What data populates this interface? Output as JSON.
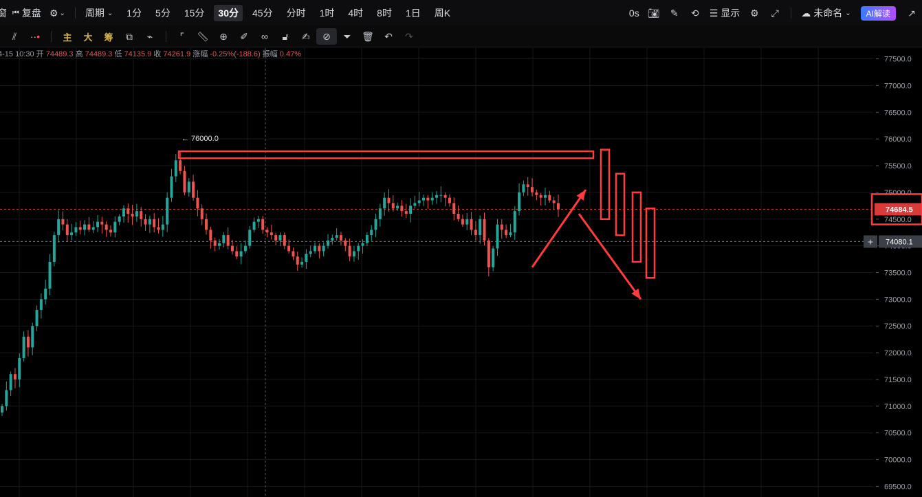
{
  "topbar": {
    "left_fragment": "窗",
    "replay_label": "复盘",
    "period_label": "周期",
    "timeframes": [
      "1分",
      "5分",
      "15分",
      "30分",
      "45分",
      "分时",
      "1时",
      "4时",
      "8时",
      "1日",
      "周K"
    ],
    "active_timeframe": "30分",
    "countdown": "0s",
    "display_label": "显示",
    "layout_name": "未命名",
    "ai_label": "AI解读"
  },
  "toolbar": {
    "indicator_main": "主",
    "indicator_big": "大",
    "indicator_chip": "筹"
  },
  "ohlc": {
    "date": "4-15 10:30",
    "open_label": "开",
    "open": "74489.3",
    "high_label": "高",
    "high": "74489.3",
    "low_label": "低",
    "low": "74135.9",
    "close_label": "收",
    "close": "74261.9",
    "change_label": "涨幅",
    "change": "-0.25%(-188.6)",
    "amp_label": "振幅",
    "amp": "0.47%"
  },
  "colors": {
    "up": "#26a69a",
    "down": "#ef5350",
    "annotation": "#ff3b3b",
    "price_badge": "#d93b3b",
    "cursor_badge": "#3a3f48",
    "grid": "#16181c"
  },
  "chart_data": {
    "type": "candlestick",
    "y_axis_ticks": [
      "77500.0",
      "77000.0",
      "76500.0",
      "76000.0",
      "75500.0",
      "75000.0",
      "74500.0",
      "74000.0",
      "73500.0",
      "73000.0",
      "72500.0",
      "72000.0",
      "71500.0",
      "71000.0",
      "70500.0",
      "70000.0",
      "69500.0"
    ],
    "ylim": [
      69300,
      77700
    ],
    "high_marker": "76000.0",
    "last_price": "74684.5",
    "cursor_price": "74080.1",
    "path": [
      71000,
      71300,
      71600,
      71500,
      71900,
      72300,
      72100,
      72500,
      72800,
      73000,
      73200,
      73700,
      74200,
      74500,
      74400,
      74200,
      74250,
      74350,
      74300,
      74400,
      74300,
      74350,
      74450,
      74400,
      74300,
      74250,
      74450,
      74550,
      74700,
      74600,
      74550,
      74650,
      74500,
      74400,
      74500,
      74350,
      74300,
      74400,
      74900,
      75300,
      75600,
      75400,
      75000,
      75200,
      74900,
      74700,
      74500,
      74300,
      74100,
      74000,
      74050,
      74200,
      74000,
      73900,
      73800,
      73900,
      74000,
      74300,
      74450,
      74500,
      74300,
      74250,
      74200,
      74100,
      74200,
      74000,
      73900,
      73800,
      73650,
      73700,
      73850,
      73900,
      74000,
      73900,
      74000,
      74100,
      74150,
      74200,
      74100,
      74000,
      73800,
      73900,
      74000,
      74050,
      74200,
      74300,
      74500,
      74700,
      74900,
      74800,
      74700,
      74750,
      74650,
      74600,
      74750,
      74800,
      74850,
      74900,
      74850,
      74900,
      74950,
      74950,
      74900,
      74800,
      74600,
      74500,
      74400,
      74500,
      74300,
      74200,
      74500,
      74100,
      73600,
      73950,
      74400,
      74300,
      74200,
      74250,
      74650,
      75000,
      75150,
      75100,
      75000,
      74950,
      74900,
      74950,
      74850,
      74800,
      74684
    ]
  },
  "annotations": {
    "resistance_box": {
      "price_top": 75770,
      "price_bottom": 75640
    },
    "down_boxes": [
      {
        "price_top": 75800,
        "price_bottom": 74500
      },
      {
        "price_top": 75350,
        "price_bottom": 74200
      },
      {
        "price_top": 75000,
        "price_bottom": 73700
      },
      {
        "price_top": 74700,
        "price_bottom": 73400
      }
    ],
    "arrow_up": {
      "from": 73600,
      "to": 75050
    },
    "arrow_down": {
      "from": 74600,
      "to": 73000
    }
  }
}
